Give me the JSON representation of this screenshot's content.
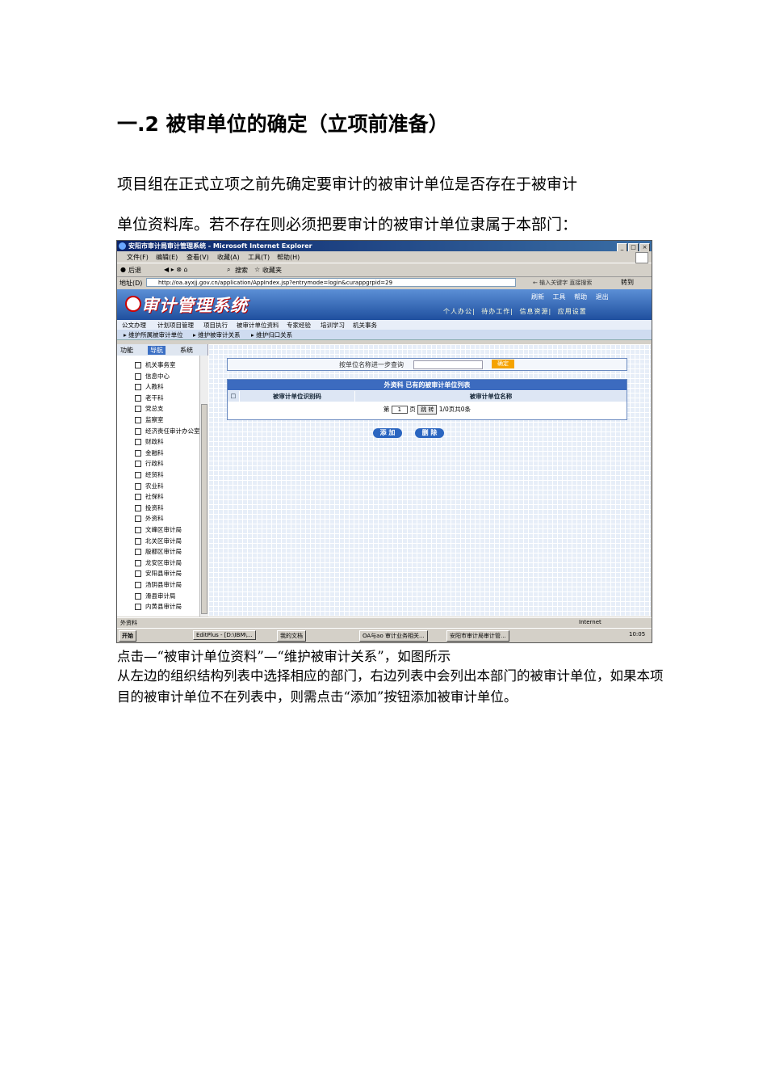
{
  "doc": {
    "heading": "一.2 被审单位的确定（立项前准备）",
    "para1": "项目组在正式立项之前先确定要审计的被审计单位是否存在于被审计",
    "para2": "单位资料库。若不存在则必须把要审计的被审计单位隶属于本部门：",
    "caption1": "点击—“被审计单位资料”—“维护被审计关系”，如图所示",
    "caption2": "从左边的组织结构列表中选择相应的部门，右边列表中会列出本部门的被审计单位，如果本项目的被审计单位不在列表中，则需点击“添加”按钮添加被审计单位。"
  },
  "window": {
    "title": "安阳市审计局审计管理系统 - Microsoft Internet Explorer",
    "min": "_",
    "max": "□",
    "close": "×"
  },
  "menu": [
    "文件(F)",
    "编辑(E)",
    "查看(V)",
    "收藏(A)",
    "工具(T)",
    "帮助(H)"
  ],
  "toolbar": {
    "back": "后退",
    "search": "搜索",
    "favorites": "收藏夹"
  },
  "address": {
    "label": "地址(D)",
    "url": "http://oa.ayxjj.gov.cn/application/AppIndex.jsp?entrymode=login&curappgrpid=29",
    "hint": "← 输入关键字  直接搜索",
    "go": "转到"
  },
  "app": {
    "title": "审计管理系统",
    "header_links": [
      "刷新",
      "工具",
      "帮助",
      "退出"
    ],
    "header_nav": [
      "个人办公",
      "待办工作",
      "信息资源",
      "应用设置"
    ],
    "tabs": [
      "公文办理",
      "计划项目管理",
      "项目执行",
      "被审计单位资料",
      "专家经验",
      "培训学习",
      "机关事务"
    ],
    "subtabs": [
      "维护所属被审计单位",
      "维护被审计关系",
      "维护归口关系"
    ]
  },
  "leftpane": {
    "tabs": [
      "功能",
      "导航",
      "系统"
    ],
    "items": [
      "机关事务室",
      "信息中心",
      "人教科",
      "老干科",
      "党总支",
      "监察室",
      "经济责任审计办公室",
      "财政科",
      "金融科",
      "行政科",
      "经贸科",
      "农业科",
      "社保科",
      "投资科",
      "外资科",
      "文峰区审计局",
      "北关区审计局",
      "殷都区审计局",
      "龙安区审计局",
      "安阳县审计局",
      "汤阴县审计局",
      "滑县审计局",
      "内黄县审计局"
    ]
  },
  "main": {
    "search_label": "按单位名称进一步查询",
    "search_ok": "确定",
    "list_title": "外资科  已有的被审计单位列表",
    "col_id": "被审计单位识别码",
    "col_name": "被审计单位名称",
    "pager_prefix": "第",
    "page_value": "1",
    "pager_page": "页",
    "jump": "跳 转",
    "pager_info": "1/0页共0条",
    "add": "添 加",
    "delete": "删 除"
  },
  "status": {
    "left": "外资科",
    "zone": "Internet"
  },
  "taskbar": {
    "start": "开始",
    "tasks": [
      "EditPlus - [D:\\IBM\\...",
      "我的文档",
      "OA与ao 审计业务相关...",
      "安阳市审计局审计管..."
    ],
    "clock": "10:05"
  }
}
